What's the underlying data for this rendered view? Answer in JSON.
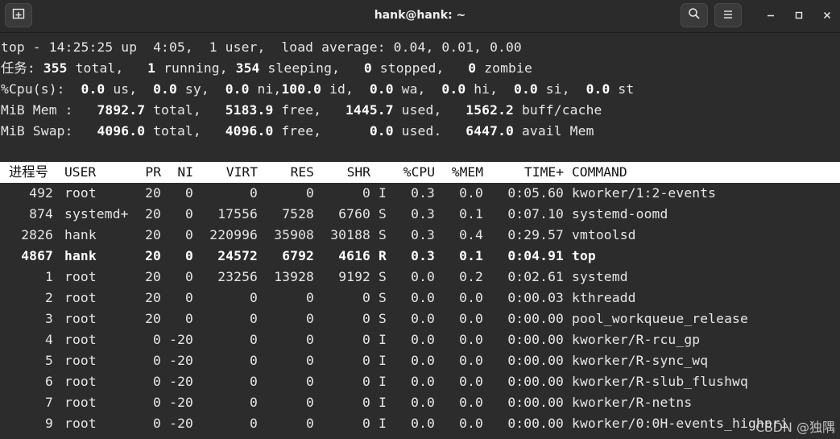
{
  "window": {
    "title": "hank@hank: ~"
  },
  "icons": {
    "new_tab": "new-tab-icon",
    "search": "search-icon",
    "menu": "hamburger-menu-icon",
    "minimize": "minimize-icon",
    "maximize": "maximize-icon",
    "close": "close-icon"
  },
  "summary": {
    "line1": "top - 14:25:25 up  4:05,  1 user,  load average: 0.04, 0.01, 0.00",
    "tasks": {
      "label": "任务:",
      "total": "355",
      "total_l": " total,",
      "running": "1",
      "running_l": " running,",
      "sleeping": "354",
      "sleeping_l": " sleeping,",
      "stopped": "0",
      "stopped_l": " stopped,",
      "zombie": "0",
      "zombie_l": " zombie"
    },
    "cpu": {
      "label": "%Cpu(s):",
      "us": "0.0",
      "us_l": " us,",
      "sy": "0.0",
      "sy_l": " sy,",
      "ni": "0.0",
      "ni_l": " ni,",
      "id": "100.0",
      "id_l": " id,",
      "wa": "0.0",
      "wa_l": " wa,",
      "hi": "0.0",
      "hi_l": " hi,",
      "si": "0.0",
      "si_l": " si,",
      "st": "0.0",
      "st_l": " st"
    },
    "mem": {
      "label": "MiB Mem :",
      "total": "7892.7",
      "total_l": " total,",
      "free": "5183.9",
      "free_l": " free,",
      "used": "1445.7",
      "used_l": " used,",
      "buff": "1562.2",
      "buff_l": " buff/cache"
    },
    "swap": {
      "label": "MiB Swap:",
      "total": "4096.0",
      "total_l": " total,",
      "free": "4096.0",
      "free_l": " free,",
      "used": "0.0",
      "used_l": " used.",
      "avail": "6447.0",
      "avail_l": " avail Mem"
    }
  },
  "table": {
    "headers": [
      "进程号",
      "USER",
      "PR",
      "NI",
      "VIRT",
      "RES",
      "SHR",
      "",
      "%CPU",
      "%MEM",
      "TIME+",
      "COMMAND"
    ],
    "rows": [
      {
        "pid": "492",
        "user": "root",
        "pr": "20",
        "ni": "0",
        "virt": "0",
        "res": "0",
        "shr": "0",
        "s": "I",
        "cpu": "0.3",
        "mem": "0.0",
        "time": "0:05.60",
        "cmd": "kworker/1:2-events",
        "bold": false
      },
      {
        "pid": "874",
        "user": "systemd+",
        "pr": "20",
        "ni": "0",
        "virt": "17556",
        "res": "7528",
        "shr": "6760",
        "s": "S",
        "cpu": "0.3",
        "mem": "0.1",
        "time": "0:07.10",
        "cmd": "systemd-oomd",
        "bold": false
      },
      {
        "pid": "2826",
        "user": "hank",
        "pr": "20",
        "ni": "0",
        "virt": "220996",
        "res": "35908",
        "shr": "30188",
        "s": "S",
        "cpu": "0.3",
        "mem": "0.4",
        "time": "0:29.57",
        "cmd": "vmtoolsd",
        "bold": false
      },
      {
        "pid": "4867",
        "user": "hank",
        "pr": "20",
        "ni": "0",
        "virt": "24572",
        "res": "6792",
        "shr": "4616",
        "s": "R",
        "cpu": "0.3",
        "mem": "0.1",
        "time": "0:04.91",
        "cmd": "top",
        "bold": true
      },
      {
        "pid": "1",
        "user": "root",
        "pr": "20",
        "ni": "0",
        "virt": "23256",
        "res": "13928",
        "shr": "9192",
        "s": "S",
        "cpu": "0.0",
        "mem": "0.2",
        "time": "0:02.61",
        "cmd": "systemd",
        "bold": false
      },
      {
        "pid": "2",
        "user": "root",
        "pr": "20",
        "ni": "0",
        "virt": "0",
        "res": "0",
        "shr": "0",
        "s": "S",
        "cpu": "0.0",
        "mem": "0.0",
        "time": "0:00.03",
        "cmd": "kthreadd",
        "bold": false
      },
      {
        "pid": "3",
        "user": "root",
        "pr": "20",
        "ni": "0",
        "virt": "0",
        "res": "0",
        "shr": "0",
        "s": "S",
        "cpu": "0.0",
        "mem": "0.0",
        "time": "0:00.00",
        "cmd": "pool_workqueue_release",
        "bold": false
      },
      {
        "pid": "4",
        "user": "root",
        "pr": "0",
        "ni": "-20",
        "virt": "0",
        "res": "0",
        "shr": "0",
        "s": "I",
        "cpu": "0.0",
        "mem": "0.0",
        "time": "0:00.00",
        "cmd": "kworker/R-rcu_gp",
        "bold": false
      },
      {
        "pid": "5",
        "user": "root",
        "pr": "0",
        "ni": "-20",
        "virt": "0",
        "res": "0",
        "shr": "0",
        "s": "I",
        "cpu": "0.0",
        "mem": "0.0",
        "time": "0:00.00",
        "cmd": "kworker/R-sync_wq",
        "bold": false
      },
      {
        "pid": "6",
        "user": "root",
        "pr": "0",
        "ni": "-20",
        "virt": "0",
        "res": "0",
        "shr": "0",
        "s": "I",
        "cpu": "0.0",
        "mem": "0.0",
        "time": "0:00.00",
        "cmd": "kworker/R-slub_flushwq",
        "bold": false
      },
      {
        "pid": "7",
        "user": "root",
        "pr": "0",
        "ni": "-20",
        "virt": "0",
        "res": "0",
        "shr": "0",
        "s": "I",
        "cpu": "0.0",
        "mem": "0.0",
        "time": "0:00.00",
        "cmd": "kworker/R-netns",
        "bold": false
      },
      {
        "pid": "9",
        "user": "root",
        "pr": "0",
        "ni": "-20",
        "virt": "0",
        "res": "0",
        "shr": "0",
        "s": "I",
        "cpu": "0.0",
        "mem": "0.0",
        "time": "0:00.00",
        "cmd": "kworker/0:0H-events_highpri",
        "bold": false
      }
    ]
  },
  "watermark": "CSDN @独隅"
}
